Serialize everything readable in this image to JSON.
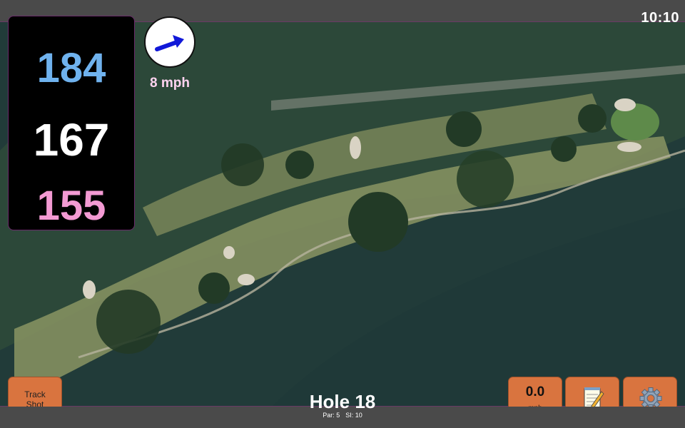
{
  "status": {
    "time": "10:10"
  },
  "distances": {
    "back": "184",
    "center": "167",
    "front": "155"
  },
  "wind": {
    "speed_text": "8 mph",
    "icon": "wind-arrow-icon"
  },
  "controls": {
    "track_shot_line1": "Track",
    "track_shot_line2": "Shot",
    "speed_value": "0.0",
    "speed_unit": "mph",
    "notes_icon": "notepad-icon",
    "settings_icon": "gear-icon"
  },
  "hole": {
    "title": "Hole 18",
    "par": "Par: 5",
    "si": "SI: 10"
  },
  "colors": {
    "back": "#6fb2ee",
    "center": "#ffffff",
    "front": "#f39ad3",
    "button": "#d9743f"
  }
}
